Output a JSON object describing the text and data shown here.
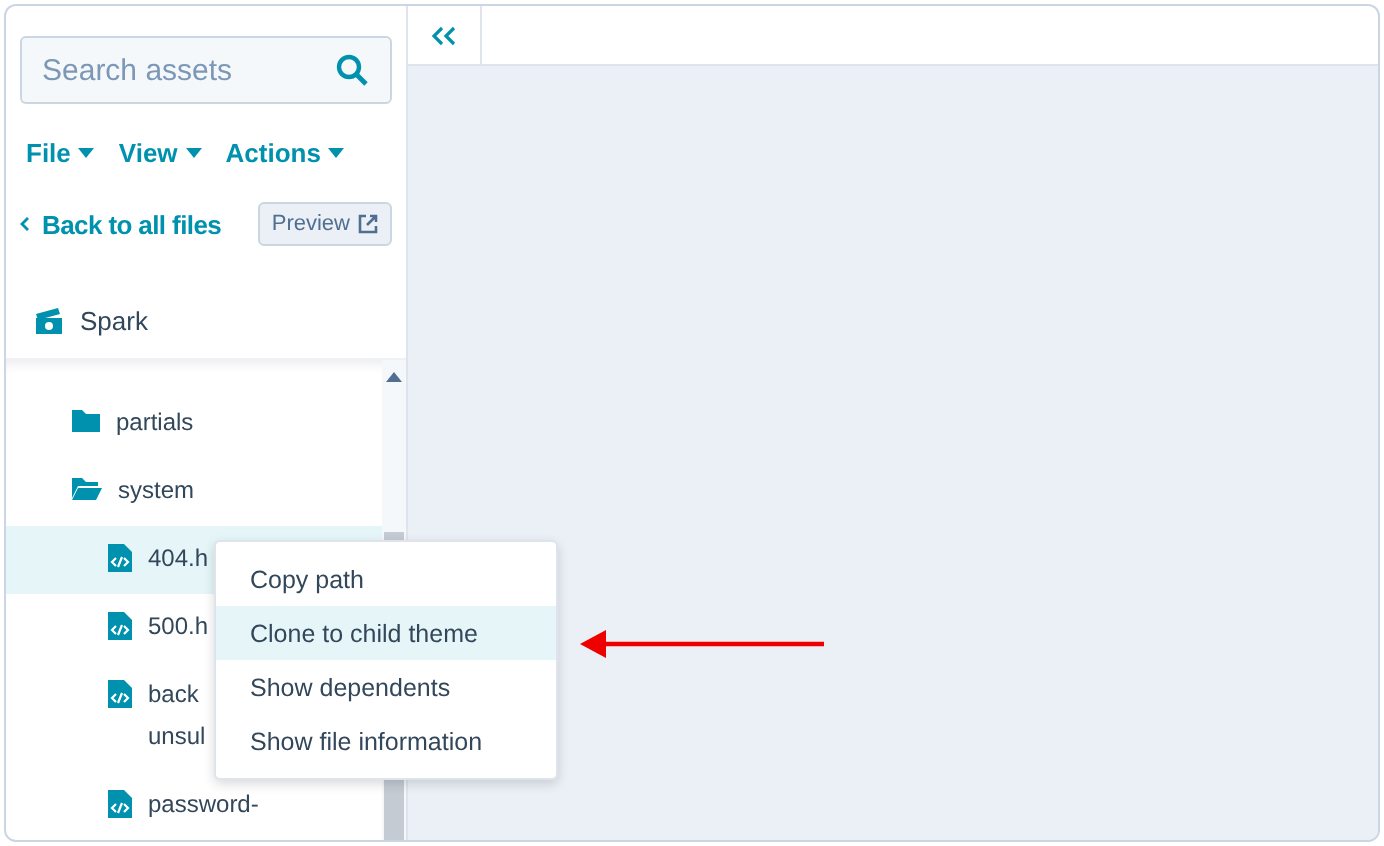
{
  "search": {
    "placeholder": "Search assets"
  },
  "menus": [
    {
      "label": "File"
    },
    {
      "label": "View"
    },
    {
      "label": "Actions"
    }
  ],
  "back_link": "Back to all files",
  "preview_button": "Preview",
  "theme": "Spark",
  "tree": [
    {
      "label": "partials",
      "kind": "folder",
      "expanded": false,
      "selected": false
    },
    {
      "label": "system",
      "kind": "folder",
      "expanded": true,
      "selected": false,
      "children": [
        {
          "label": "404.h",
          "kind": "file",
          "selected": true
        },
        {
          "label": "500.h",
          "kind": "file",
          "selected": false
        },
        {
          "label": "back\nunsul",
          "kind": "file",
          "selected": false
        },
        {
          "label": "password-",
          "kind": "file",
          "selected": false
        }
      ]
    }
  ],
  "context_menu": [
    {
      "label": "Copy path",
      "selected": false
    },
    {
      "label": "Clone to child theme",
      "selected": true
    },
    {
      "label": "Show dependents",
      "selected": false
    },
    {
      "label": "Show file information",
      "selected": false
    }
  ]
}
